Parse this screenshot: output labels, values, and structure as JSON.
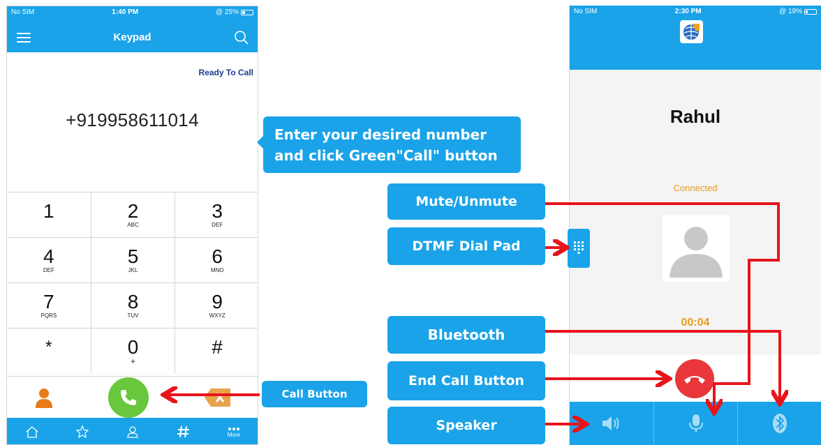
{
  "left_phone": {
    "status": {
      "carrier": "No SIM",
      "time": "1:40 PM",
      "battery": "@ 25%"
    },
    "title": "Keypad",
    "ready_label": "Ready To Call",
    "number": "+919958611014",
    "keys": [
      [
        {
          "digit": "1",
          "letters": ""
        },
        {
          "digit": "2",
          "letters": "ABC"
        },
        {
          "digit": "3",
          "letters": "DEF"
        }
      ],
      [
        {
          "digit": "4",
          "letters": "DEF"
        },
        {
          "digit": "5",
          "letters": "JKL"
        },
        {
          "digit": "6",
          "letters": "MNO"
        }
      ],
      [
        {
          "digit": "7",
          "letters": "PQRS"
        },
        {
          "digit": "8",
          "letters": "TUV"
        },
        {
          "digit": "9",
          "letters": "WXYZ"
        }
      ],
      [
        {
          "digit": "*",
          "letters": ""
        },
        {
          "digit": "0",
          "letters": "+"
        },
        {
          "digit": "#",
          "letters": ""
        }
      ]
    ],
    "tabs": [
      "home-icon",
      "star-icon",
      "contacts-icon",
      "hash-icon",
      "more-icon"
    ],
    "more_label": "More"
  },
  "callouts": {
    "enter_line1": "Enter your desired number",
    "enter_line2": "and click Green\"Call\" button",
    "call_button": "Call Button",
    "mute": "Mute/Unmute",
    "dtmf": "DTMF Dial Pad",
    "bluetooth": "Bluetooth",
    "end_call": "End Call Button",
    "speaker": "Speaker"
  },
  "right_phone": {
    "status": {
      "carrier": "No SIM",
      "time": "2:30 PM",
      "battery": "@ 19%"
    },
    "caller_name": "Rahul",
    "call_status": "Connected",
    "timer": "00:04",
    "controls": [
      "speaker-icon",
      "microphone-icon",
      "bluetooth-icon"
    ]
  },
  "colors": {
    "primary": "#1aa3e8",
    "call_green": "#68c73c",
    "end_red": "#e8363a",
    "accent_orange": "#e89a1a",
    "arrow_red": "#e8141c"
  }
}
